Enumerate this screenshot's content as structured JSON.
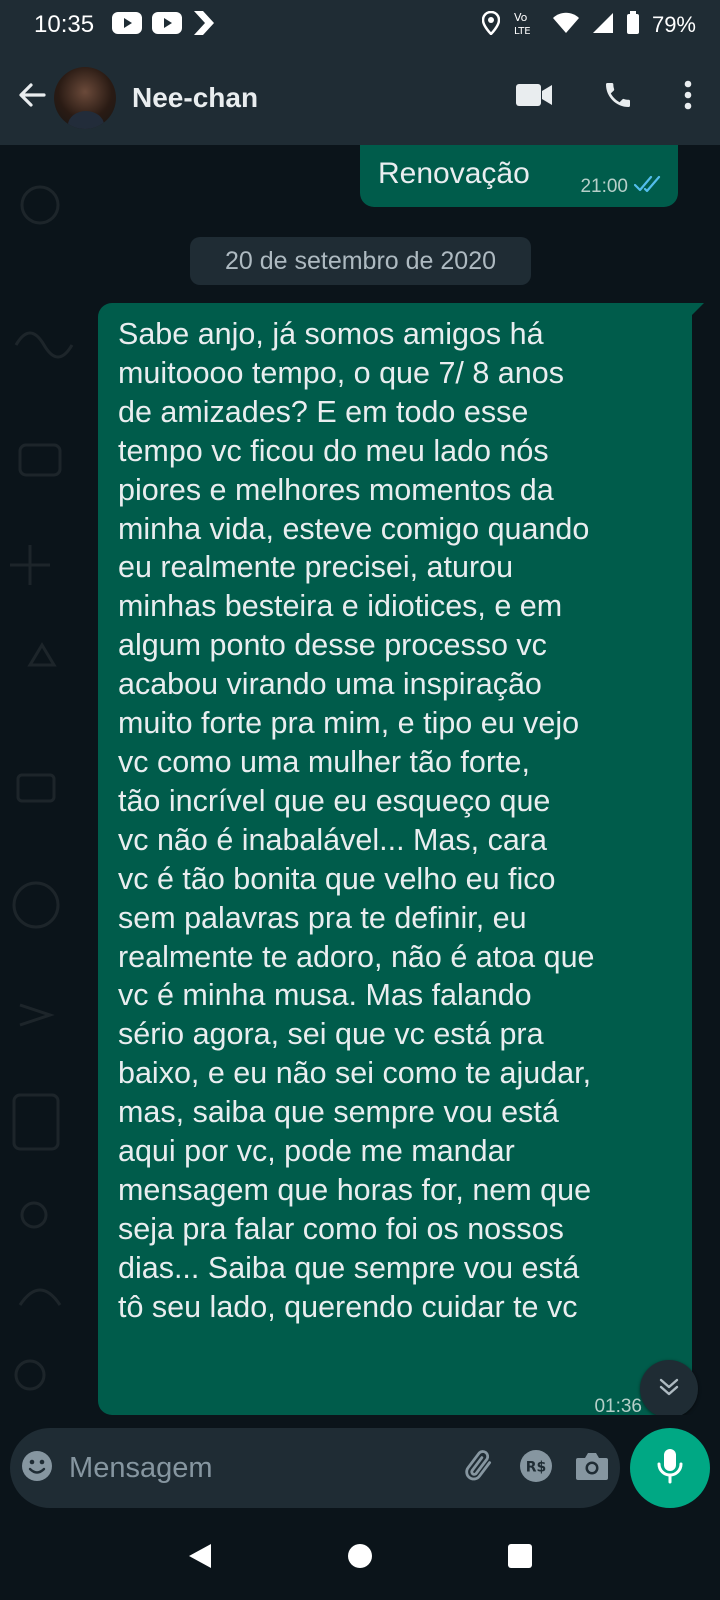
{
  "status_bar": {
    "time": "10:35",
    "battery_percent": "79%",
    "icons": [
      "youtube-icon",
      "youtube-icon",
      "plex-icon",
      "location-icon",
      "volte-icon",
      "wifi-icon",
      "signal-icon",
      "battery-icon"
    ]
  },
  "header": {
    "contact_name": "Nee-chan",
    "icons": [
      "back-arrow-icon",
      "avatar",
      "video-call-icon",
      "phone-icon",
      "more-vert-icon"
    ]
  },
  "chat": {
    "messages": [
      {
        "direction": "outgoing",
        "text": "Renovação",
        "time": "21:00",
        "status": "read"
      },
      {
        "type": "date_separator",
        "text": "20 de setembro de 2020"
      },
      {
        "direction": "outgoing",
        "lines": [
          "Sabe anjo, já somos amigos há",
          "muitoooo tempo, o que 7/ 8 anos",
          "de amizades? E em todo esse",
          "tempo vc ficou do meu lado nós",
          "piores e melhores momentos da",
          "minha vida, esteve comigo quando",
          "eu realmente precisei, aturou",
          "minhas besteira e idiotices, e em",
          "algum ponto desse processo vc",
          "acabou virando uma inspiração",
          "muito forte pra mim, e tipo eu vejo",
          "vc como uma mulher tão forte,",
          "tão incrível que eu esqueço que",
          "vc não é inabalável... Mas, cara",
          "vc é tão bonita que velho eu fico",
          "sem palavras pra te definir, eu",
          "realmente te adoro, não é atoa que",
          "vc é minha musa. Mas falando",
          "sério agora, sei que vc está pra",
          "baixo, e eu não sei como te ajudar,",
          "mas, saiba que sempre vou está",
          "aqui por vc, pode me mandar",
          "mensagem que horas for, nem que",
          "seja pra falar como foi os nossos",
          "dias... Saiba que sempre vou está",
          "tô seu lado, querendo cuidar te vc"
        ],
        "time": "01:36",
        "status": "read"
      }
    ]
  },
  "composer": {
    "placeholder": "Mensagem",
    "icons": [
      "emoji-icon",
      "attach-icon",
      "payment-icon",
      "camera-icon",
      "mic-icon"
    ]
  },
  "colors": {
    "background": "#0b141a",
    "header": "#1f2c34",
    "outgoing_bubble": "#005c4b",
    "accent": "#00a884",
    "read_ticks": "#53bdeb"
  }
}
